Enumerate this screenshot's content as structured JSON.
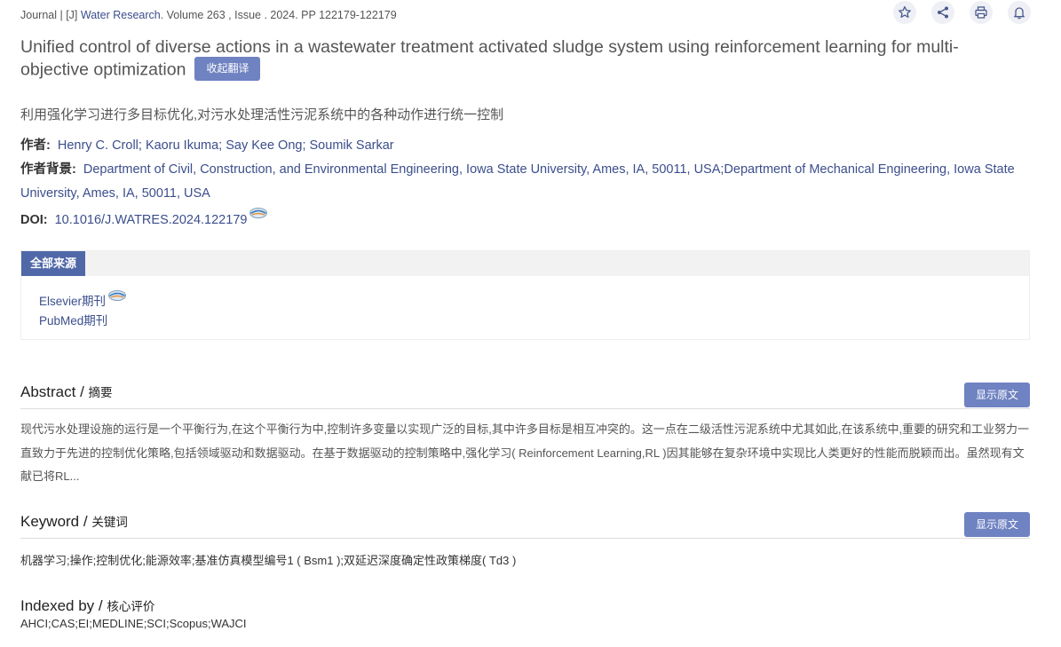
{
  "header": {
    "prefix": "Journal | [J]",
    "journal": "Water Research",
    "details": ". Volume 263 , Issue . 2024. PP 122179-122179"
  },
  "actions": {
    "favorite_icon": "star-icon",
    "share_icon": "share-icon",
    "print_icon": "print-icon",
    "alert_icon": "bell-icon"
  },
  "article": {
    "title": "Unified control of diverse actions in a wastewater treatment activated sludge system using reinforcement learning for multi-objective optimization",
    "collapse_button": "收起翻译",
    "cn_title": "利用强化学习进行多目标优化,对污水处理活性污泥系统中的各种动作进行统一控制"
  },
  "meta": {
    "authors_label": "作者:",
    "authors": "Henry C. Croll; Kaoru Ikuma; Say Kee Ong; Soumik Sarkar",
    "affil_label": "作者背景:",
    "affiliations": "Department of Civil, Construction, and Environmental Engineering, Iowa State University, Ames, IA, 50011, USA;Department of Mechanical Engineering, Iowa State University, Ames, IA, 50011, USA",
    "doi_label": "DOI:",
    "doi": "10.1016/J.WATRES.2024.122179"
  },
  "sources": {
    "tab": "全部来源",
    "items": [
      "Elsevier期刊",
      "PubMed期刊"
    ]
  },
  "abstract": {
    "title": "Abstract /",
    "title_cn": "摘要",
    "show_original": "显示原文",
    "text": "现代污水处理设施的运行是一个平衡行为,在这个平衡行为中,控制许多变量以实现广泛的目标,其中许多目标是相互冲突的。这一点在二级活性污泥系统中尤其如此,在该系统中,重要的研究和工业努力一直致力于先进的控制优化策略,包括领域驱动和数据驱动。在基于数据驱动的控制策略中,强化学习( Reinforcement Learning,RL )因其能够在复杂环境中实现比人类更好的性能而脱颖而出。虽然现有文献已将RL..."
  },
  "keywords": {
    "title": "Keyword /",
    "title_cn": "关键词",
    "show_original": "显示原文",
    "text": "机器学习;操作;控制优化;能源效率;基准仿真模型编号1 ( Bsm1 );双延迟深度确定性政策梯度( Td3 )"
  },
  "indexed": {
    "title": "Indexed by /",
    "title_cn": "核心评价",
    "text": "AHCI;CAS;EI;MEDLINE;SCI;Scopus;WAJCI"
  },
  "colors": {
    "link": "#3b4e8c",
    "button": "#6f82c1",
    "tab": "#5068a8"
  }
}
